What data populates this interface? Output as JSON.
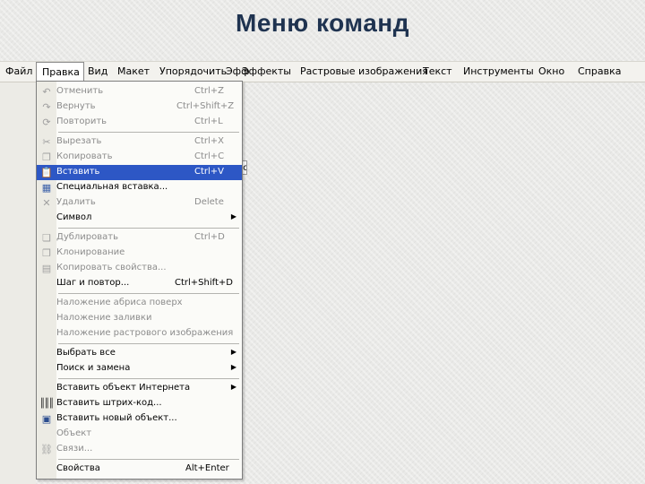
{
  "slide": {
    "title": "Меню команд"
  },
  "menubar": {
    "items": [
      "Файл",
      "Правка",
      "Вид",
      "Макет",
      "Упорядочить",
      "Эфф",
      "Эффекты",
      "Растровые изображения",
      "Текст",
      "Инструменты",
      "Окно",
      "Справка"
    ]
  },
  "behind": {
    "fragment": "ес"
  },
  "dropdown": {
    "items": [
      {
        "label": "Отменить",
        "shortcut": "Ctrl+Z",
        "icon": "undo-icon"
      },
      {
        "label": "Вернуть",
        "shortcut": "Ctrl+Shift+Z",
        "icon": "redo-icon"
      },
      {
        "label": "Повторить",
        "shortcut": "Ctrl+L",
        "icon": "repeat-icon"
      },
      {
        "label": "Вырезать",
        "shortcut": "Ctrl+X",
        "icon": "scissors-icon"
      },
      {
        "label": "Копировать",
        "shortcut": "Ctrl+C",
        "icon": "copy-icon"
      },
      {
        "label": "Вставить",
        "shortcut": "Ctrl+V",
        "icon": "paste-icon"
      },
      {
        "label": "Специальная вставка...",
        "shortcut": "",
        "icon": "paste-special-icon"
      },
      {
        "label": "Удалить",
        "shortcut": "Delete",
        "icon": "delete-icon"
      },
      {
        "label": "Символ",
        "shortcut": "",
        "icon": ""
      },
      {
        "label": "Дублировать",
        "shortcut": "Ctrl+D",
        "icon": "duplicate-icon"
      },
      {
        "label": "Клонирование",
        "shortcut": "",
        "icon": "clone-icon"
      },
      {
        "label": "Копировать свойства...",
        "shortcut": "",
        "icon": "copy-properties-icon"
      },
      {
        "label": "Шаг и повтор...",
        "shortcut": "Ctrl+Shift+D",
        "icon": ""
      },
      {
        "label": "Наложение абриса поверх",
        "shortcut": "",
        "icon": ""
      },
      {
        "label": "Наложение заливки",
        "shortcut": "",
        "icon": ""
      },
      {
        "label": "Наложение растрового изображения",
        "shortcut": "",
        "icon": ""
      },
      {
        "label": "Выбрать все",
        "shortcut": "",
        "icon": ""
      },
      {
        "label": "Поиск и замена",
        "shortcut": "",
        "icon": ""
      },
      {
        "label": "Вставить объект Интернета",
        "shortcut": "",
        "icon": ""
      },
      {
        "label": "Вставить штрих-код...",
        "shortcut": "",
        "icon": "barcode-icon"
      },
      {
        "label": "Вставить новый объект...",
        "shortcut": "",
        "icon": "new-object-icon"
      },
      {
        "label": "Объект",
        "shortcut": "",
        "icon": ""
      },
      {
        "label": "Связи...",
        "shortcut": "",
        "icon": "links-icon"
      },
      {
        "label": "Свойства",
        "shortcut": "Alt+Enter",
        "icon": ""
      }
    ]
  }
}
